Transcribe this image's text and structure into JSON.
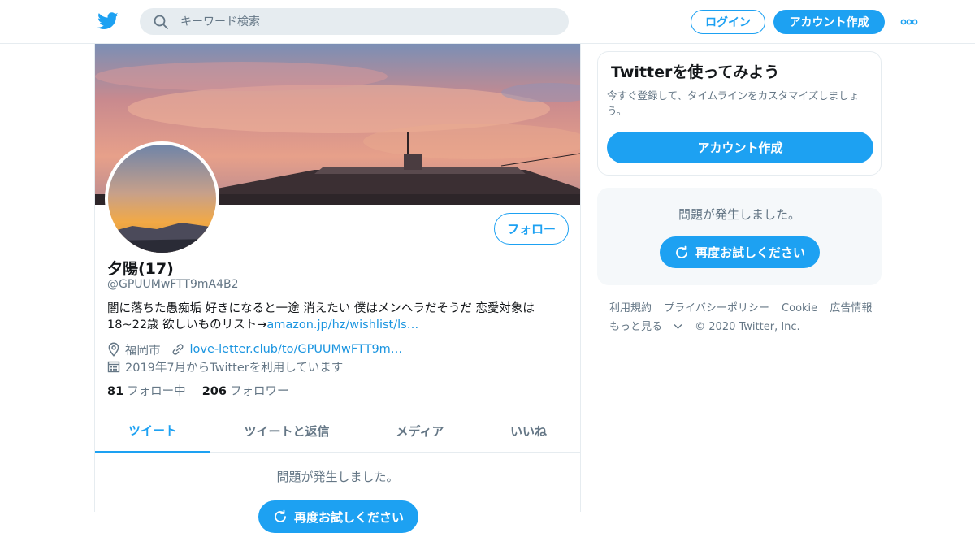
{
  "header": {
    "logo": "twitter-bird-icon",
    "search_placeholder": "キーワード検索",
    "login_label": "ログイン",
    "signup_label": "アカウント作成",
    "more_icon": "more-dots-icon"
  },
  "profile": {
    "name": "夕陽(17)",
    "handle": "@GPUUMwFTT9mA4B2",
    "bio_text": "闇に落ちた愚痴垢 好きになると一途 消えたい 僕はメンヘラだそうだ 恋愛対象は18~22歳 欲しいものリスト→",
    "bio_link": "amazon.jp/hz/wishlist/ls…",
    "location": "福岡市",
    "website": "love-letter.club/to/GPUUMwFTT9m…",
    "joined": "2019年7月からTwitterを利用しています",
    "following_count": "81",
    "following_label": "フォロー中",
    "followers_count": "206",
    "followers_label": "フォロワー",
    "follow_button": "フォロー"
  },
  "tabs": [
    {
      "label": "ツイート",
      "active": true
    },
    {
      "label": "ツイートと返信",
      "active": false
    },
    {
      "label": "メディア",
      "active": false
    },
    {
      "label": "いいね",
      "active": false
    }
  ],
  "timeline": {
    "error_text": "問題が発生しました。",
    "retry_label": "再度お試しください"
  },
  "sidebar": {
    "promo_title": "Twitterを使ってみよう",
    "promo_desc": "今すぐ登録して、タイムラインをカスタマイズしましょう。",
    "promo_button": "アカウント作成",
    "error_text": "問題が発生しました。",
    "retry_label": "再度お試しください"
  },
  "footer": {
    "links": [
      "利用規約",
      "プライバシーポリシー",
      "Cookie",
      "広告情報",
      "もっと見る"
    ],
    "copyright": "© 2020 Twitter, Inc."
  },
  "colors": {
    "accent": "#1da1f2",
    "link": "#1b95e0",
    "muted": "#657786",
    "text": "#14171a",
    "border": "#e6ecf0"
  }
}
